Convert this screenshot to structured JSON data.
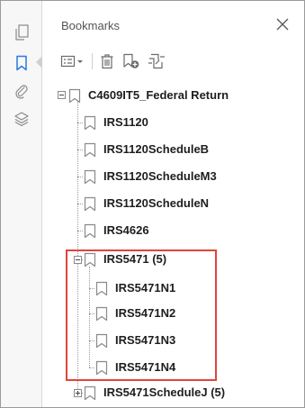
{
  "panel": {
    "title": "Bookmarks",
    "close_icon": "close-icon"
  },
  "rail": {
    "icons": [
      "pages-icon",
      "bookmark-icon",
      "attachment-icon",
      "layers-icon"
    ],
    "selected": "bookmark-icon"
  },
  "toolbar": {
    "icons": [
      "options-menu-icon",
      "delete-icon",
      "new-bookmark-icon",
      "expand-bookmark-icon"
    ]
  },
  "tree": {
    "root": {
      "label": "C4609IT5_Federal Return",
      "expanded": true
    },
    "items": [
      {
        "label": "IRS1120"
      },
      {
        "label": "IRS1120ScheduleB"
      },
      {
        "label": "IRS1120ScheduleM3"
      },
      {
        "label": "IRS1120ScheduleN"
      },
      {
        "label": "IRS4626"
      },
      {
        "label": "IRS5471 (5)",
        "expanded": true,
        "children": [
          {
            "label": "IRS5471N1"
          },
          {
            "label": "IRS5471N2"
          },
          {
            "label": "IRS5471N3"
          },
          {
            "label": "IRS5471N4"
          }
        ]
      },
      {
        "label": "IRS5471ScheduleJ (5)",
        "expanded": false
      }
    ]
  },
  "colors": {
    "highlight": "#e0453a",
    "selected_icon": "#2a7ae2",
    "icon_gray": "#8a8a8a"
  }
}
